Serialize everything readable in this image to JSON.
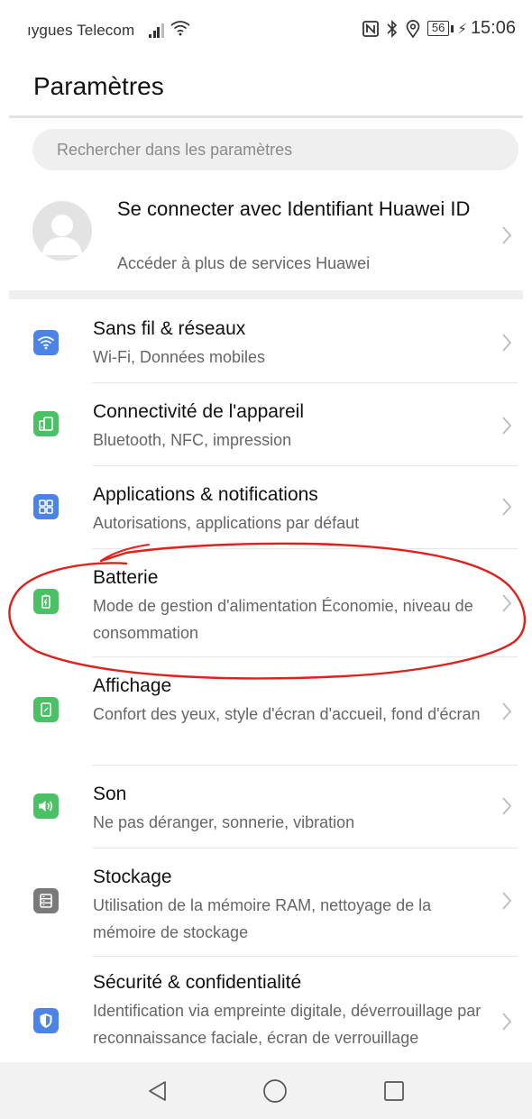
{
  "status_bar": {
    "carrier": "ıygues Telecom",
    "battery_level": "56",
    "charging_symbol": "⚡",
    "time": "15:06"
  },
  "header": {
    "title": "Paramètres"
  },
  "search": {
    "placeholder": "Rechercher dans les paramètres"
  },
  "account": {
    "title": "Se connecter avec Identifiant Huawei ID",
    "subtitle": "Accéder à plus de services Huawei"
  },
  "settings": [
    {
      "title": "Sans fil & réseaux",
      "subtitle": "Wi-Fi, Données mobiles",
      "icon": "wifi-icon",
      "color": "#4b84e6"
    },
    {
      "title": "Connectivité de l'appareil",
      "subtitle": "Bluetooth, NFC, impression",
      "icon": "device-connectivity-icon",
      "color": "#4cc064"
    },
    {
      "title": "Applications & notifications",
      "subtitle": "Autorisations, applications par défaut",
      "icon": "apps-grid-icon",
      "color": "#4b84e6"
    },
    {
      "title": "Batterie",
      "subtitle": "Mode de gestion d'alimentation Économie, niveau de consommation",
      "icon": "battery-icon",
      "color": "#4cc064"
    },
    {
      "title": "Affichage",
      "subtitle": "Confort des yeux, style d'écran d'accueil, fond d'écran",
      "icon": "display-icon",
      "color": "#4cc064"
    },
    {
      "title": "Son",
      "subtitle": "Ne pas déranger, sonnerie, vibration",
      "icon": "speaker-icon",
      "color": "#4cc064"
    },
    {
      "title": "Stockage",
      "subtitle": "Utilisation de la mémoire RAM, nettoyage de la mémoire de stockage",
      "icon": "storage-icon",
      "color": "#7a7a7a"
    },
    {
      "title": "Sécurité & confidentialité",
      "subtitle": "Identification via empreinte digitale, déverrouillage par reconnaissance faciale, écran de verrouillage",
      "icon": "shield-icon",
      "color": "#4b84e6"
    }
  ],
  "colors": {
    "annotation_red": "#e0201b",
    "divider": "#e6e6e6",
    "secondary_text": "#666666"
  }
}
